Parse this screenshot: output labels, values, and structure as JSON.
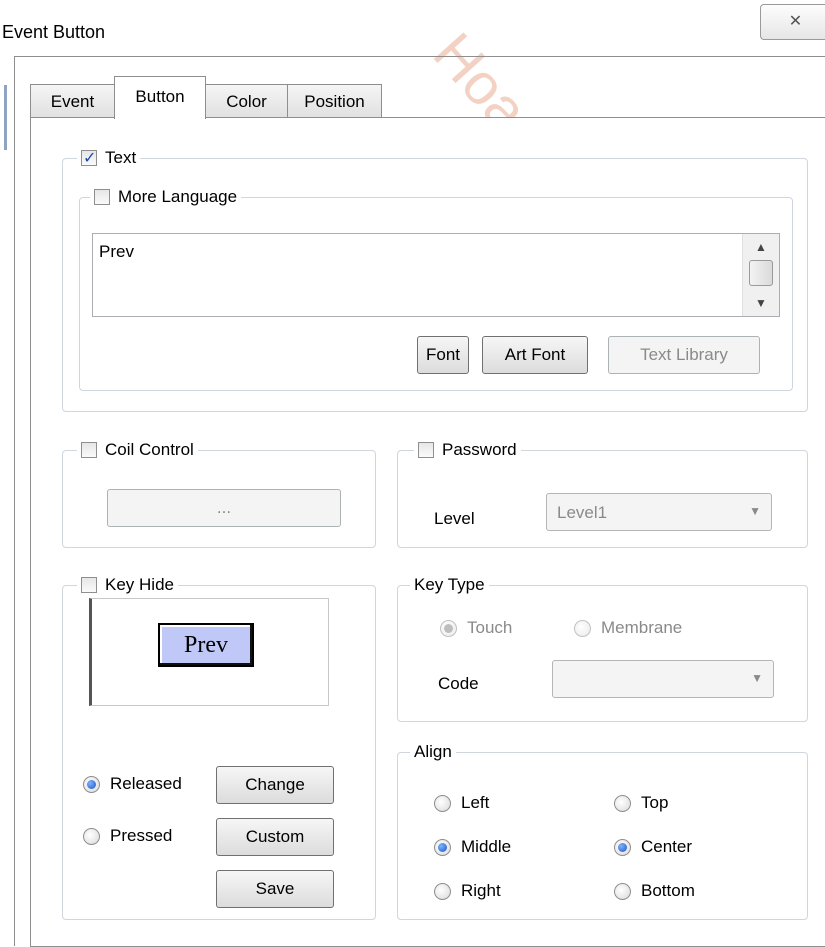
{
  "window": {
    "title": "Event Button",
    "close_glyph": "✕"
  },
  "watermark": "Hoanghoatoan",
  "tabs": [
    {
      "label": "Event",
      "active": false
    },
    {
      "label": "Button",
      "active": true
    },
    {
      "label": "Color",
      "active": false
    },
    {
      "label": "Position",
      "active": false
    }
  ],
  "text_group": {
    "label": "Text",
    "checked": true,
    "more_language": {
      "label": "More Language",
      "checked": false
    },
    "text_value": "Prev",
    "buttons": {
      "font": "Font",
      "art_font": "Art Font",
      "text_library": "Text Library"
    }
  },
  "coil_control": {
    "label": "Coil Control",
    "checked": false,
    "browse_label": "..."
  },
  "password": {
    "label": "Password",
    "checked": false,
    "level_label": "Level",
    "level_value": "Level1"
  },
  "key_hide": {
    "label": "Key Hide",
    "checked": false,
    "preview_text": "Prev"
  },
  "key_type": {
    "label": "Key Type",
    "touch": "Touch",
    "membrane": "Membrane",
    "selected": "Touch",
    "code_label": "Code",
    "code_value": ""
  },
  "state": {
    "released": "Released",
    "pressed": "Pressed",
    "selected": "Released",
    "change": "Change",
    "custom": "Custom",
    "save": "Save"
  },
  "align": {
    "label": "Align",
    "left": "Left",
    "middle": "Middle",
    "right": "Right",
    "top": "Top",
    "center": "Center",
    "bottom": "Bottom",
    "horizontal_selected": "Middle",
    "vertical_selected": "Center"
  },
  "icons": {
    "close": "close-icon",
    "dropdown": "chevron-down-icon",
    "scroll_up": "scroll-up-icon",
    "scroll_down": "scroll-down-icon"
  },
  "colors": {
    "preview_button_bg": "#bfc8f6",
    "radio_selected": "#1c55c8",
    "checkbox_check": "#1a4aa8",
    "group_border": "#cfd6de"
  }
}
